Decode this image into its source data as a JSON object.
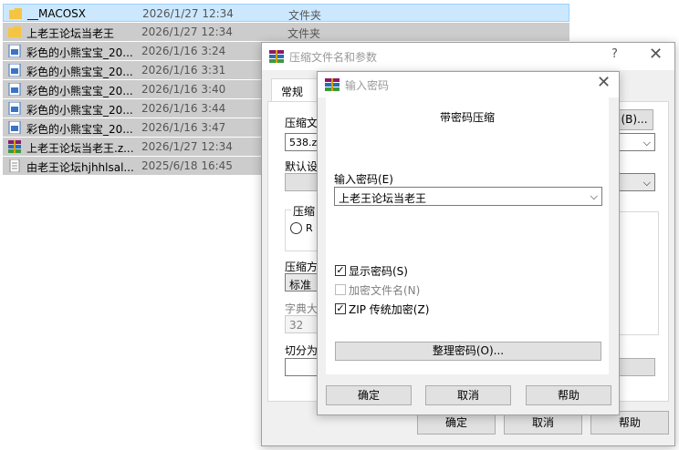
{
  "file_list": [
    {
      "name": "__MACOSX",
      "date": "2026/1/27 12:34",
      "type": "文件夹",
      "icon": "folder-icon",
      "selected": true
    },
    {
      "name": "上老王论坛当老王",
      "date": "2026/1/27 12:34",
      "type": "文件夹",
      "icon": "folder-icon",
      "selected": false
    },
    {
      "name": "彩色的小熊宝宝_20...",
      "date": "2026/1/16 3:24",
      "type": "",
      "icon": "image-file-icon",
      "selected": false
    },
    {
      "name": "彩色的小熊宝宝_20...",
      "date": "2026/1/16 3:31",
      "type": "",
      "icon": "image-file-icon",
      "selected": false
    },
    {
      "name": "彩色的小熊宝宝_20...",
      "date": "2026/1/16 3:40",
      "type": "",
      "icon": "image-file-icon",
      "selected": false
    },
    {
      "name": "彩色的小熊宝宝_20...",
      "date": "2026/1/16 3:44",
      "type": "",
      "icon": "image-file-icon",
      "selected": false
    },
    {
      "name": "彩色的小熊宝宝_20...",
      "date": "2026/1/16 3:47",
      "type": "",
      "icon": "image-file-icon",
      "selected": false
    },
    {
      "name": "上老王论坛当老王.z...",
      "date": "2026/1/27 12:34",
      "type": "",
      "icon": "winrar-archive-icon",
      "selected": false
    },
    {
      "name": "由老王论坛hjhhlsal...",
      "date": "2025/6/18 16:45",
      "type": "",
      "icon": "text-file-icon",
      "selected": false
    }
  ],
  "back_dialog": {
    "title": "压缩文件名和参数",
    "help_glyph": "?",
    "close_glyph": "✕",
    "tab_general": "常规",
    "archive_name_label": "压缩文",
    "archive_name_value": "538.zip",
    "browse_button": "(B)...",
    "default_profile_label": "默认设",
    "format_group_label": "压缩",
    "radio_label": "R",
    "method_label": "压缩方",
    "method_value": "标准",
    "dict_label": "字典大",
    "dict_value": "32",
    "split_label": "切分为",
    "ok_button": "确定",
    "cancel_button": "取消",
    "help_button": "帮助"
  },
  "password_dialog": {
    "title": "输入密码",
    "close_glyph": "✕",
    "heading": "带密码压缩",
    "password_label": "输入密码(E)",
    "password_value": "上老王论坛当老王",
    "show_password_label": "显示密码(S)",
    "show_password_checked": true,
    "encrypt_names_label": "加密文件名(N)",
    "encrypt_names_checked": false,
    "zip_legacy_label": "ZIP 传统加密(Z)",
    "zip_legacy_checked": true,
    "organize_button": "整理密码(O)...",
    "ok_button": "确定",
    "cancel_button": "取消",
    "help_button": "帮助"
  },
  "colors": {
    "selection": "#cce8ff",
    "row_gray": "#cccccc",
    "dialog_bg": "#f0f0f0",
    "button": "#e1e1e1"
  }
}
